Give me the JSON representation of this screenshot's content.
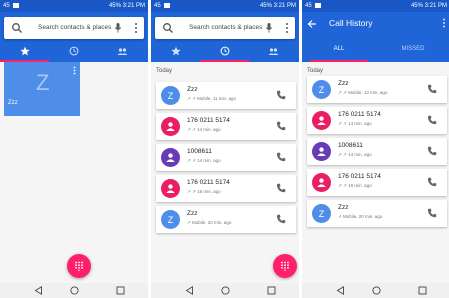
{
  "status": {
    "left_text": "45",
    "battery": "45%",
    "time": "3:21 PM"
  },
  "search": {
    "placeholder": "Search contacts & places"
  },
  "favorites": {
    "tile": {
      "letter": "Z",
      "name": "Zzz"
    }
  },
  "recents": {
    "section_label": "Today",
    "items": [
      {
        "letter": "Z",
        "name": "Zzz",
        "detail": "Mobile, 11 min. ago",
        "arrows": "↗ ↗",
        "color": "#4e8de8",
        "icon": "letter"
      },
      {
        "letter": "",
        "name": "176 0211 5174",
        "detail": "14 min. ago",
        "arrows": "↗ ↗",
        "color": "#e91e63",
        "icon": "person-icon"
      },
      {
        "letter": "",
        "name": "1008611",
        "detail": "14 min. ago",
        "arrows": "↗ ↗",
        "color": "#673ab7",
        "icon": "person-icon"
      },
      {
        "letter": "",
        "name": "176 0211 5174",
        "detail": "19 min. ago",
        "arrows": "↗ ↗",
        "color": "#e91e63",
        "icon": "person-icon"
      },
      {
        "letter": "Z",
        "name": "Zzz",
        "detail": "Mobile, 20 min. ago",
        "arrows": "↗",
        "color": "#4e8de8",
        "icon": "letter"
      }
    ]
  },
  "call_history": {
    "title": "Call History",
    "tab_all": "ALL",
    "tab_missed": "MISSED",
    "section_label": "Today",
    "items": [
      {
        "letter": "Z",
        "name": "Zzz",
        "detail": "Mobile, 13 min. ago",
        "arrows": "↗ ↗",
        "color": "#4e8de8",
        "icon": "letter"
      },
      {
        "letter": "",
        "name": "176 0211 5174",
        "detail": "14 min. ago",
        "arrows": "↗ ↗",
        "color": "#e91e63",
        "icon": "person-icon"
      },
      {
        "letter": "",
        "name": "1008611",
        "detail": "14 min. ago",
        "arrows": "↗ ↗",
        "color": "#673ab7",
        "icon": "person-icon"
      },
      {
        "letter": "",
        "name": "176 0211 5174",
        "detail": "19 min. ago",
        "arrows": "↗ ↗",
        "color": "#e91e63",
        "icon": "person-icon"
      },
      {
        "letter": "Z",
        "name": "Zzz",
        "detail": "Mobile, 20 min. ago",
        "arrows": "↗",
        "color": "#4e8de8",
        "icon": "letter"
      }
    ]
  },
  "colors": {
    "primary": "#1f65d8",
    "status_bar": "#1a57c6",
    "accent": "#ff1f6b"
  },
  "icons": [
    "search-icon",
    "mic-icon",
    "overflow-menu-icon",
    "star-icon",
    "clock-icon",
    "contacts-icon",
    "phone-icon",
    "dialpad-icon",
    "back-arrow-icon",
    "nav-back-icon",
    "nav-home-icon",
    "nav-recent-icon"
  ]
}
